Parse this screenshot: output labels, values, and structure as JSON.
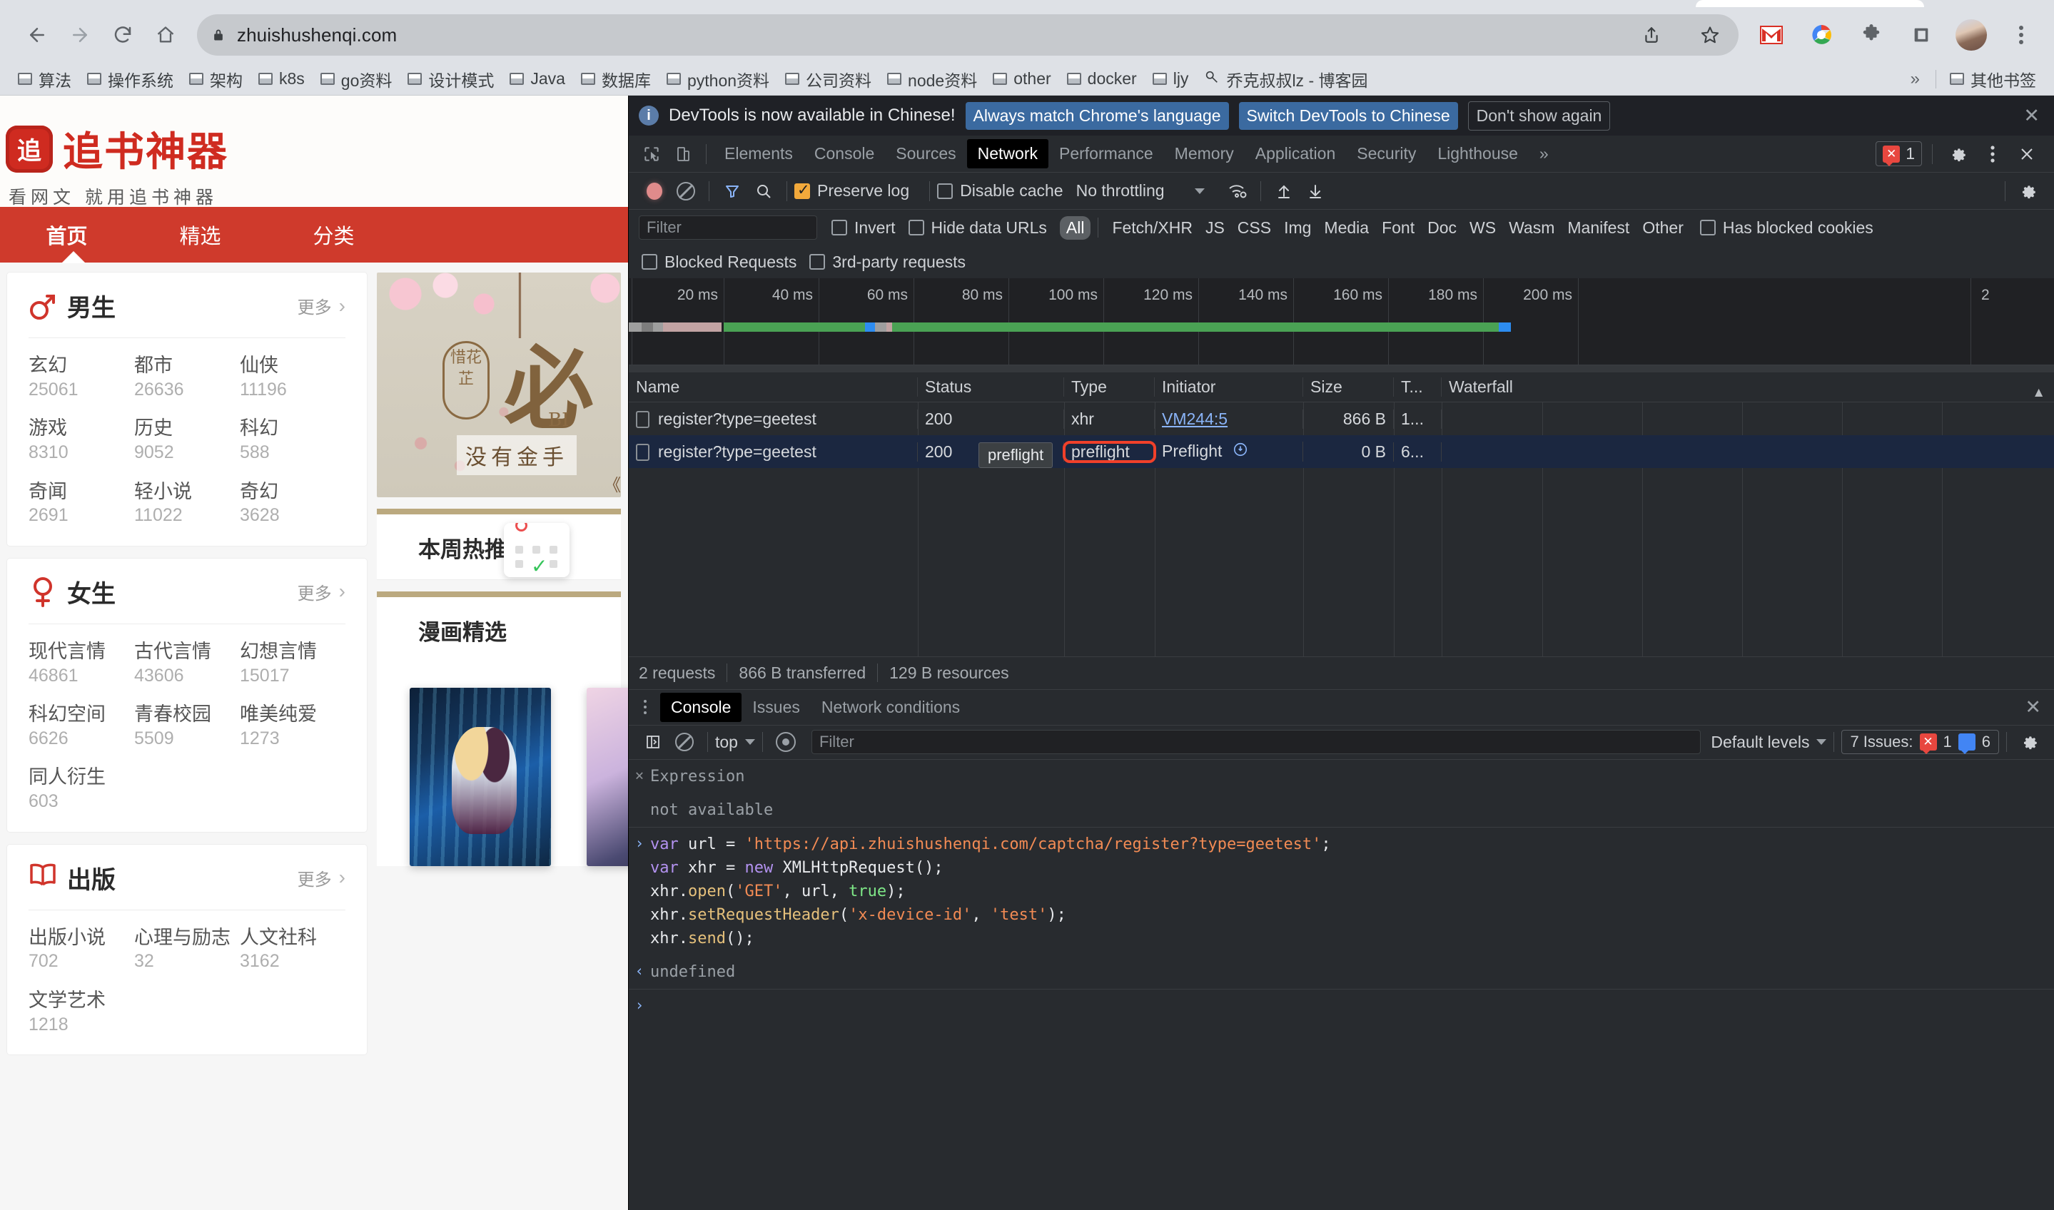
{
  "browser": {
    "url": "zhuishushenqi.com",
    "nav": {
      "back": "back-arrow",
      "forward": "forward-arrow",
      "reload": "reload",
      "home": "home"
    },
    "bookmarks": [
      "算法",
      "操作系统",
      "架构",
      "k8s",
      "go资料",
      "设计模式",
      "Java",
      "数据库",
      "python资料",
      "公司资料",
      "node资料",
      "other",
      "docker",
      "ljy"
    ],
    "bookmark_link": "乔克叔叔lz - 博客园",
    "bookmarks_overflow": "»",
    "other_bookmarks": "其他书签"
  },
  "site": {
    "logo_mark": "追",
    "logo_text": "追书神器",
    "slogan": "看网文 就用追书神器",
    "nav": [
      "首页",
      "精选",
      "分类"
    ],
    "banner": {
      "seal": "惜花芷",
      "big": "必",
      "bi": "BI",
      "sub": "没有金手",
      "quote": "《惜"
    },
    "sections": [
      {
        "title": "本周热推"
      },
      {
        "title": "漫画精选"
      }
    ],
    "categories": [
      {
        "icon": "male-icon",
        "title": "男生",
        "more": "更多",
        "items": [
          {
            "name": "玄幻",
            "count": "25061"
          },
          {
            "name": "都市",
            "count": "26636"
          },
          {
            "name": "仙侠",
            "count": "11196"
          },
          {
            "name": "游戏",
            "count": "8310"
          },
          {
            "name": "历史",
            "count": "9052"
          },
          {
            "name": "科幻",
            "count": "588"
          },
          {
            "name": "奇闻",
            "count": "2691"
          },
          {
            "name": "轻小说",
            "count": "11022"
          },
          {
            "name": "奇幻",
            "count": "3628"
          }
        ]
      },
      {
        "icon": "female-icon",
        "title": "女生",
        "more": "更多",
        "items": [
          {
            "name": "现代言情",
            "count": "46861"
          },
          {
            "name": "古代言情",
            "count": "43606"
          },
          {
            "name": "幻想言情",
            "count": "15017"
          },
          {
            "name": "科幻空间",
            "count": "6626"
          },
          {
            "name": "青春校园",
            "count": "5509"
          },
          {
            "name": "唯美纯爱",
            "count": "1273"
          },
          {
            "name": "同人衍生",
            "count": "603"
          }
        ]
      },
      {
        "icon": "book-icon",
        "title": "出版",
        "more": "更多",
        "items": [
          {
            "name": "出版小说",
            "count": "702"
          },
          {
            "name": "心理与励志",
            "count": "32"
          },
          {
            "name": "人文社科",
            "count": "3162"
          },
          {
            "name": "文学艺术",
            "count": "1218"
          }
        ]
      }
    ]
  },
  "devtools": {
    "infobar": {
      "message": "DevTools is now available in Chinese!",
      "primary_button": "Always match Chrome's language",
      "secondary_button": "Switch DevTools to Chinese",
      "tertiary_button": "Don't show again",
      "close": "✕"
    },
    "tabs": [
      "Elements",
      "Console",
      "Sources",
      "Network",
      "Performance",
      "Memory",
      "Application",
      "Security",
      "Lighthouse"
    ],
    "active_tab": "Network",
    "tabs_overflow": "»",
    "error_count": "1",
    "network_toolbar": {
      "preserve_log_label": "Preserve log",
      "preserve_log_checked": true,
      "disable_cache_label": "Disable cache",
      "disable_cache_checked": false,
      "throttling": "No throttling"
    },
    "network_filters": {
      "filter_placeholder": "Filter",
      "filter_value": "",
      "invert_label": "Invert",
      "hide_data_urls_label": "Hide data URLs",
      "types": [
        "All",
        "Fetch/XHR",
        "JS",
        "CSS",
        "Img",
        "Media",
        "Font",
        "Doc",
        "WS",
        "Wasm",
        "Manifest",
        "Other"
      ],
      "active_type": "All",
      "has_blocked_cookies_label": "Has blocked cookies",
      "blocked_requests_label": "Blocked Requests",
      "third_party_label": "3rd-party requests"
    },
    "timeline_ticks": [
      "20 ms",
      "40 ms",
      "60 ms",
      "80 ms",
      "100 ms",
      "120 ms",
      "140 ms",
      "160 ms",
      "180 ms",
      "200 ms",
      "2"
    ],
    "table": {
      "columns": [
        "Name",
        "Status",
        "Type",
        "Initiator",
        "Size",
        "T...",
        "Waterfall"
      ],
      "rows": [
        {
          "name": "register?type=geetest",
          "status": "200",
          "type": "xhr",
          "initiator": "VM244:5",
          "size": "866 B",
          "time": "1...",
          "selected": false
        },
        {
          "name": "register?type=geetest",
          "status": "200",
          "type": "preflight",
          "initiator": "Preflight",
          "size": "0 B",
          "time": "6...",
          "selected": true
        }
      ],
      "tooltip": "preflight"
    },
    "status": {
      "requests": "2 requests",
      "transferred": "866 B transferred",
      "resources": "129 B resources"
    },
    "drawer": {
      "tabs": [
        "Console",
        "Issues",
        "Network conditions"
      ],
      "active_tab": "Console",
      "close": "✕",
      "context": "top",
      "filter_placeholder": "Filter",
      "levels": "Default levels",
      "issues_label": "7 Issues:",
      "issues_errors": "1",
      "issues_info": "6"
    },
    "console": {
      "expression_header": "Expression",
      "expression_body": "not available",
      "input_lines": [
        "var url = 'https://api.zhuishushenqi.com/captcha/register?type=geetest';",
        "var xhr = new XMLHttpRequest();",
        "xhr.open('GET', url, true);",
        "xhr.setRequestHeader('x-device-id', 'test');",
        "xhr.send();"
      ],
      "result": "undefined",
      "prompt": ">"
    }
  },
  "colors": {
    "accent_red": "#cf3a2c",
    "devtools_bg": "#282b2f",
    "link_blue": "#8ab4f8",
    "highlight_red": "#f0402a",
    "waterfall_green": "#4aa254"
  }
}
